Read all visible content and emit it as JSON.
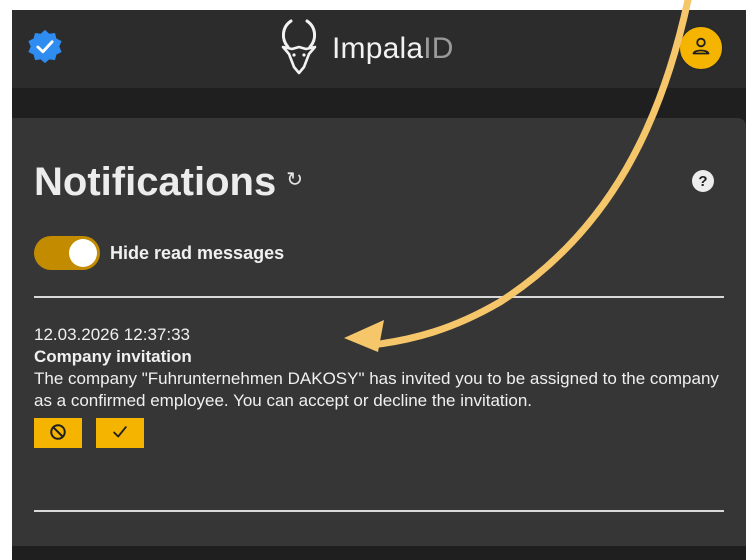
{
  "header": {
    "brand_name": "Impala",
    "brand_suffix": "ID",
    "verified_icon": "verified-badge-icon",
    "avatar_icon": "user-icon",
    "logo_icon": "impala-head-icon"
  },
  "notifications": {
    "title": "Notifications",
    "refresh_glyph": "↻",
    "help_glyph": "?",
    "toggle_label": "Hide read messages",
    "toggle_on": true
  },
  "items": [
    {
      "timestamp": "12.03.2026 12:37:33",
      "title": "Company invitation",
      "body": "The company \"Fuhrunternehmen DAKOSY\" has invited you to be assigned to the company as a confirmed employee. You can accept or decline the invitation.",
      "decline_icon": "decline-icon",
      "accept_icon": "check-icon"
    }
  ],
  "colors": {
    "accent": "#f4b400",
    "toggle": "#c28b00",
    "header_bg": "#2c2c2c",
    "panel_bg": "#363636",
    "annotation_arrow": "#f5c76a"
  }
}
